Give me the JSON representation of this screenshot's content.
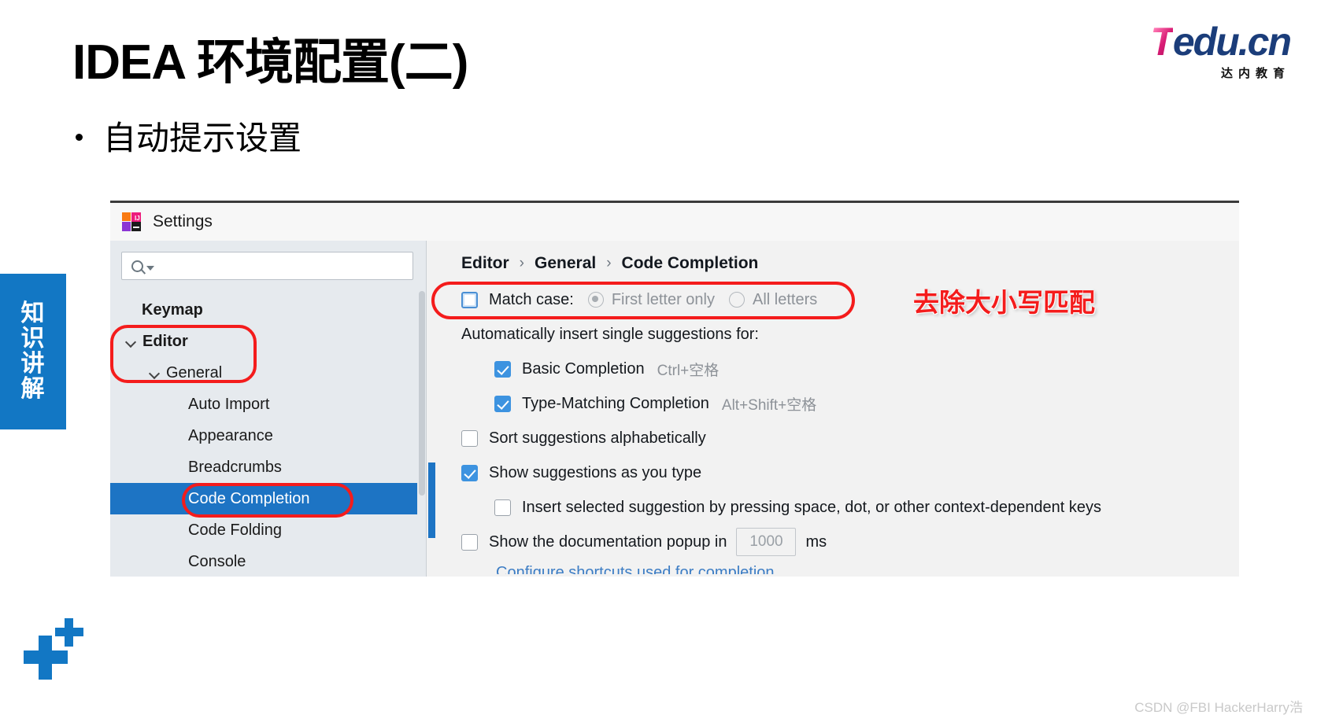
{
  "slide": {
    "title": "IDEA 环境配置(二)",
    "bullet": "自动提示设置",
    "side_badge": [
      "知",
      "识",
      "讲",
      "解"
    ],
    "watermark": "CSDN @FBI HackerHarry浩",
    "accent_blue": "#1277c4",
    "annotation_red": "#f41c1c"
  },
  "logo": {
    "brand_t": "T",
    "brand_rest": "edu.cn",
    "subtitle": "达内教育"
  },
  "settings": {
    "title": "Settings",
    "icon": "intellij-idea-icon",
    "search": {
      "value": "",
      "placeholder": "",
      "icon": "search-icon"
    },
    "tree": [
      {
        "label": "Keymap",
        "level": 0,
        "bold": true,
        "chevron": false,
        "selected": false
      },
      {
        "label": "Editor",
        "level": 0,
        "bold": true,
        "chevron": true,
        "selected": false
      },
      {
        "label": "General",
        "level": 1,
        "bold": false,
        "chevron": true,
        "selected": false
      },
      {
        "label": "Auto Import",
        "level": 2,
        "bold": false,
        "chevron": false,
        "selected": false
      },
      {
        "label": "Appearance",
        "level": 2,
        "bold": false,
        "chevron": false,
        "selected": false
      },
      {
        "label": "Breadcrumbs",
        "level": 2,
        "bold": false,
        "chevron": false,
        "selected": false
      },
      {
        "label": "Code Completion",
        "level": 2,
        "bold": false,
        "chevron": false,
        "selected": true
      },
      {
        "label": "Code Folding",
        "level": 2,
        "bold": false,
        "chevron": false,
        "selected": false
      },
      {
        "label": "Console",
        "level": 2,
        "bold": false,
        "chevron": false,
        "selected": false
      }
    ],
    "breadcrumb": {
      "items": [
        "Editor",
        "General",
        "Code Completion"
      ],
      "separator": "›"
    },
    "options": {
      "match_case": {
        "label": "Match case:",
        "checked": false,
        "radios": [
          {
            "label": "First letter only",
            "selected": true,
            "disabled": true
          },
          {
            "label": "All letters",
            "selected": false,
            "disabled": true
          }
        ]
      },
      "auto_insert_header": "Automatically insert single suggestions for:",
      "basic_completion": {
        "label": "Basic Completion",
        "checked": true,
        "shortcut": "Ctrl+空格"
      },
      "type_matching_completion": {
        "label": "Type-Matching Completion",
        "checked": true,
        "shortcut": "Alt+Shift+空格"
      },
      "sort_alphabetically": {
        "label": "Sort suggestions alphabetically",
        "checked": false
      },
      "show_as_you_type": {
        "label": "Show suggestions as you type",
        "checked": true
      },
      "insert_by_space": {
        "label": "Insert selected suggestion by pressing space, dot, or other context-dependent keys",
        "checked": false
      },
      "doc_popup": {
        "label": "Show the documentation popup in",
        "checked": false,
        "value": "1000",
        "unit": "ms"
      },
      "cut_off_link": "Configure shortcuts used for completion"
    }
  },
  "annotations": {
    "note_match_case": "去除大小写匹配"
  }
}
